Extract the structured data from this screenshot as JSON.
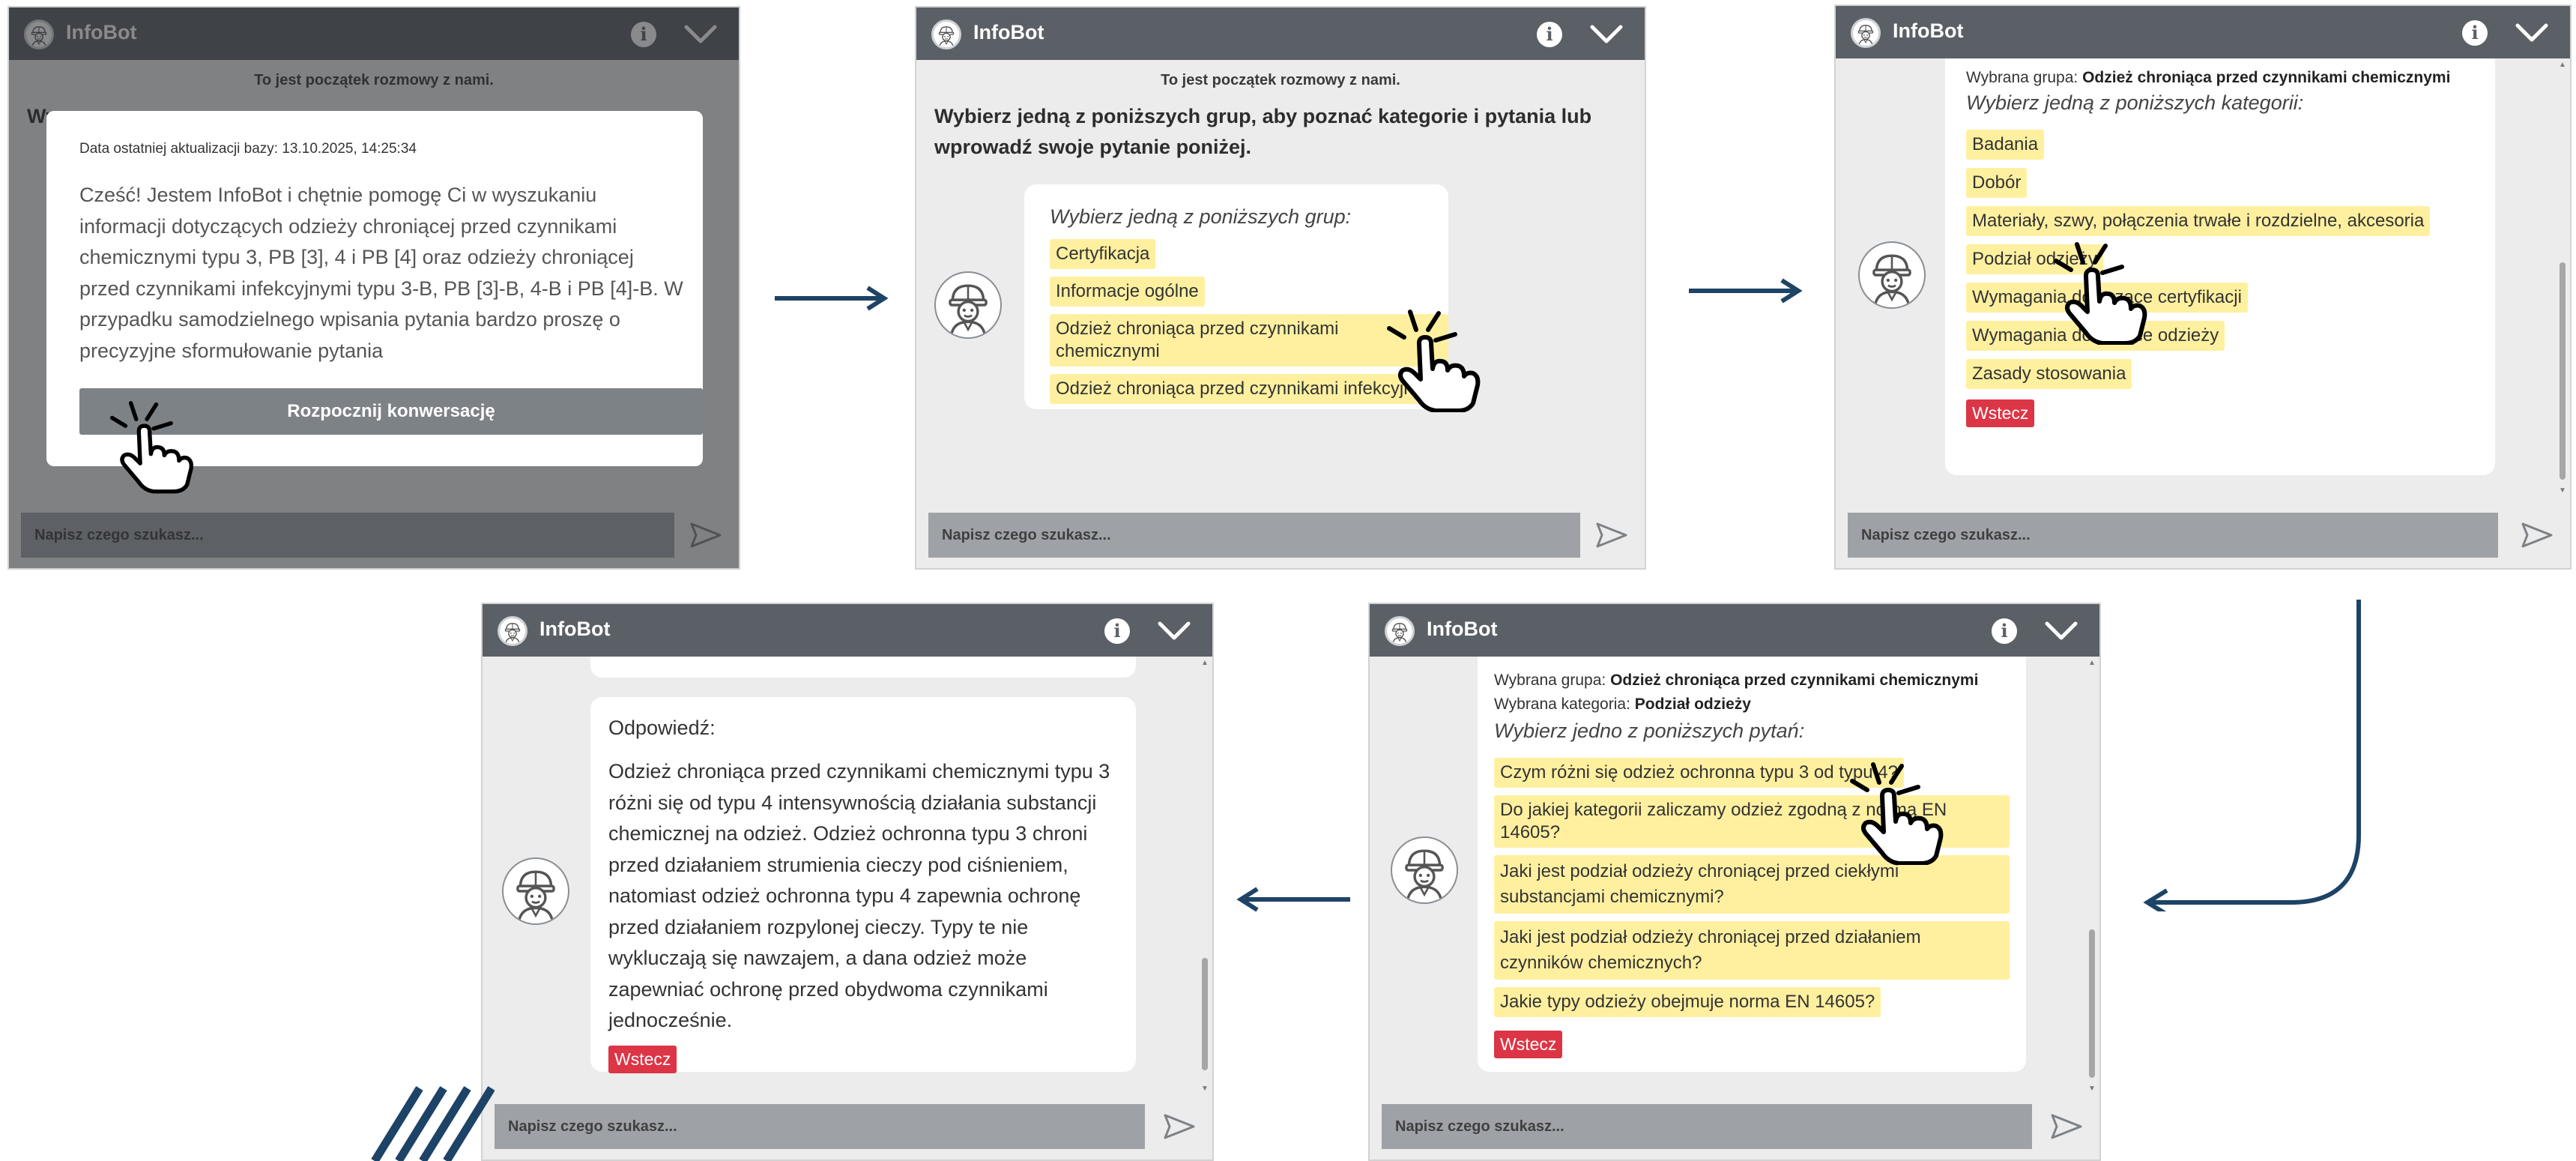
{
  "app": {
    "title": "InfoBot"
  },
  "common": {
    "input_placeholder": "Napisz czego szukasz...",
    "start_note": "To jest początek rozmowy z nami.",
    "back_label": "Wstecz",
    "info_icon": "info-icon",
    "collapse_icon": "chevron-down-icon",
    "send_icon": "send-icon",
    "avatar_icon": "worker-helmet-icon",
    "hand_icon": "tap-hand-icon"
  },
  "colors": {
    "header": "#5b6066",
    "option_highlight": "#fff0a0",
    "back_button": "#dc3545",
    "arrow": "#1d4366",
    "input_bg": "#9ea2a6"
  },
  "screen1": {
    "background_intro_fragment": "Wy",
    "modal": {
      "date": "Data ostatniej aktualizacji bazy: 13.10.2025, 14:25:34",
      "text": "Cześć! Jestem InfoBot i chętnie pomogę Ci w wyszukaniu informacji dotyczących odzieży chroniącej przed czynnikami chemicznymi typu 3, PB [3], 4 i PB [4] oraz odzieży chroniącej przed czynnikami infekcyjnymi typu 3-B, PB [3]-B, 4-B i PB [4]-B. W przypadku samodzielnego wpisania pytania bardzo proszę o precyzyjne sformułowanie pytania",
      "button": "Rozpocznij konwersację"
    }
  },
  "screen2": {
    "intro": "Wybierz jedną z poniższych grup, aby poznać kategorie i pytania lub wprowadź swoje pytanie poniżej.",
    "bubble_title": "Wybierz jedną z poniższych grup:",
    "groups": [
      "Certyfikacja",
      "Informacje ogólne",
      "Odzież chroniąca przed czynnikami chemicznymi",
      "Odzież chroniąca przed czynnikami infekcyjnymi"
    ]
  },
  "screen3": {
    "group_label": "Wybrana grupa:",
    "group_value": "Odzież chroniąca przed czynnikami chemicznymi",
    "bubble_title": "Wybierz jedną z poniższych kategorii:",
    "categories": [
      "Badania",
      "Dobór",
      "Materiały, szwy, połączenia trwałe i rozdzielne, akcesoria",
      "Podział odzieży",
      "Wymagania dotyczące certyfikacji",
      "Wymagania dotyczące odzieży",
      "Zasady stosowania"
    ]
  },
  "screen4": {
    "group_label": "Wybrana grupa:",
    "group_value": "Odzież chroniąca przed czynnikami chemicznymi",
    "category_label": "Wybrana kategoria:",
    "category_value": "Podział odzieży",
    "bubble_title": "Wybierz jedno z poniższych pytań:",
    "questions": [
      "Czym różni się odzież ochronna typu 3 od typu 4?",
      "Do jakiej kategorii zaliczamy odzież zgodną z normą EN 14605?",
      "Jaki jest podział odzieży chroniącej przed ciekłymi substancjami chemicznymi?",
      "Jaki jest podział odzieży chroniącej przed działaniem czynników chemicznych?",
      "Jakie typy odzieży obejmuje norma EN 14605?"
    ]
  },
  "screen5": {
    "answer_title": "Odpowiedź:",
    "answer_text": "Odzież chroniąca przed czynnikami chemicznymi typu 3 różni się od typu 4 intensywnością działania substancji chemicznej na odzież. Odzież ochronna typu 3 chroni przed działaniem strumienia cieczy pod ciśnieniem, natomiast odzież ochronna typu 4 zapewnia ochronę przed działaniem rozpylonej cieczy. Typy te nie wykluczają się nawzajem, a dana odzież może zapewniać ochronę przed obydwoma czynnikami jednocześnie."
  }
}
